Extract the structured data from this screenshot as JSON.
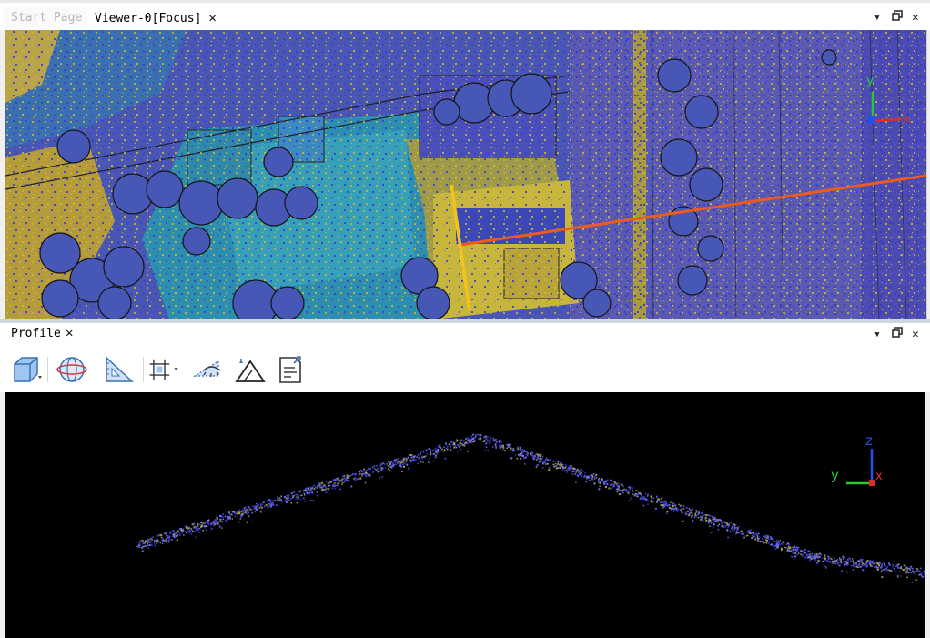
{
  "tabs": [
    {
      "label": "Start Page",
      "active": false
    },
    {
      "label": "Viewer-0[Focus]",
      "active": true
    }
  ],
  "tab_close_glyph": "✕",
  "window_controls": {
    "menu": "▾",
    "restore": "🗗",
    "close": "✕"
  },
  "profile_panel": {
    "title": "Profile",
    "close_glyph": "✕"
  },
  "toolbar_icons": [
    "box-select-icon",
    "orbit-icon",
    "ruler-triangle-icon",
    "grid-crop-icon",
    "visibility-filter-icon",
    "terrain-icon",
    "report-icon"
  ],
  "viewer_axes": {
    "x": "x",
    "y": "y"
  },
  "profile_axes": {
    "y": "y",
    "z": "z",
    "x": "x"
  },
  "colors": {
    "accent_line": "#f05a1a",
    "section_line": "#f3c21c",
    "background": "#000000"
  }
}
